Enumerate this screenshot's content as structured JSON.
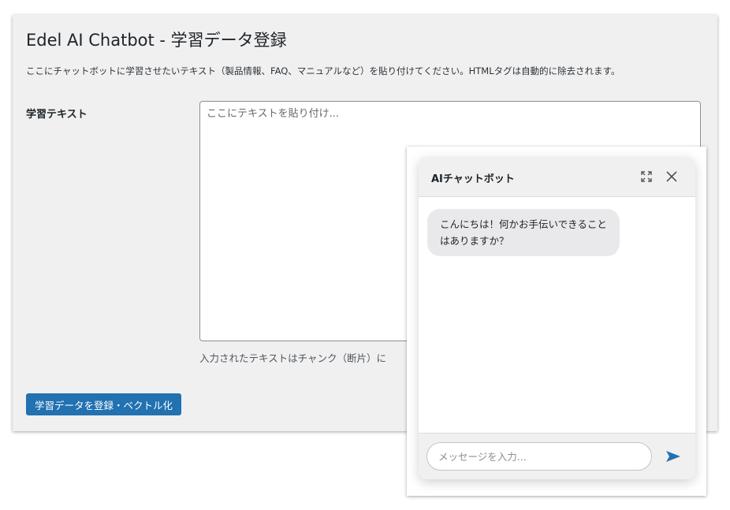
{
  "page": {
    "title": "Edel AI Chatbot - 学習データ登録",
    "description": "ここにチャットボットに学習させたいテキスト（製品情報、FAQ、マニュアルなど）を貼り付けてください。HTMLタグは自動的に除去されます。"
  },
  "form": {
    "label": "学習テキスト",
    "textarea_value": "",
    "textarea_placeholder": "ここにテキストを貼り付け...",
    "help_text": "入力されたテキストはチャンク（断片）に",
    "submit_label": "学習データを登録・ベクトル化"
  },
  "chat": {
    "title": "AIチャットボット",
    "header_icons": [
      "expand-icon",
      "close-icon"
    ],
    "messages": [
      {
        "role": "bot",
        "text": "こんにちは！何かお手伝いできることはありますか？"
      }
    ],
    "input_value": "",
    "input_placeholder": "メッセージを入力...",
    "send_icon": "send-icon"
  },
  "colors": {
    "primary_button": "#2271b1",
    "send_icon": "#2271b1",
    "admin_background": "#f0f0f1",
    "bot_bubble": "#e9e9eb"
  }
}
